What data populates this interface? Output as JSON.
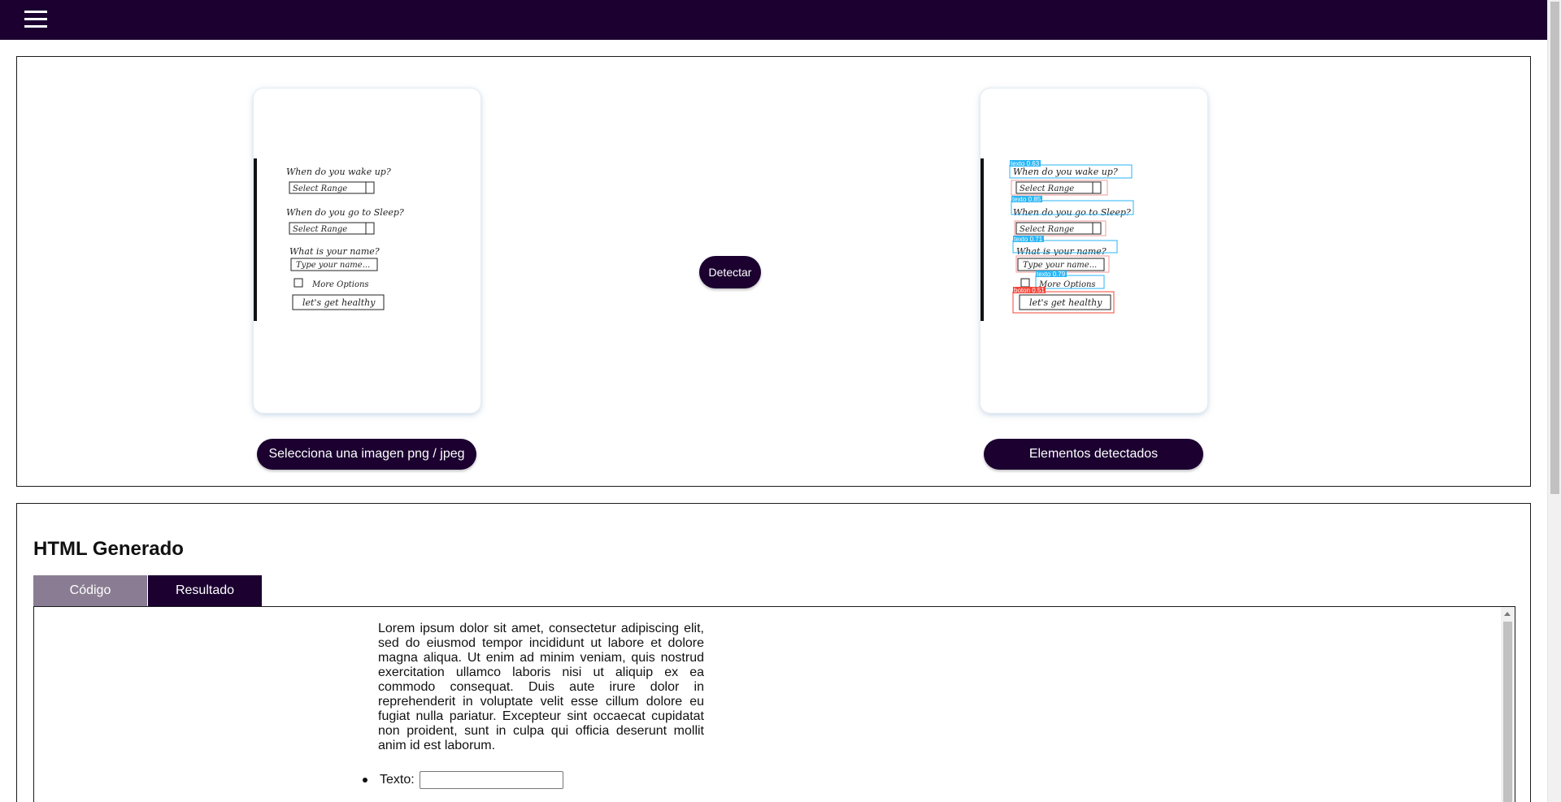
{
  "header": {
    "menu_icon": "hamburger-menu-icon"
  },
  "upload": {
    "select_button": "Selecciona una imagen png / jpeg",
    "detect_button": "Detectar",
    "detected_button": "Elementos detectados",
    "sketch_lines": [
      "When do you wake up?",
      "Select Range",
      "When do you go to Sleep?",
      "Select Range",
      "What is your name?",
      "Type your name...",
      "More Options",
      "let's get healthy"
    ],
    "detections": [
      "texto 0.63",
      "texto 0.85",
      "texto 0.71",
      "texto 0.79",
      "boton 0.51"
    ]
  },
  "generated": {
    "title": "HTML Generado",
    "tabs": [
      "Código",
      "Resultado"
    ],
    "active_tab": "Resultado",
    "paragraph": "Lorem ipsum dolor sit amet, consectetur adipiscing elit, sed do eiusmod tempor incididunt ut labore et dolore magna aliqua. Ut enim ad minim veniam, quis nostrud exercitation ullamco laboris nisi ut aliquip ex ea commodo consequat. Duis aute irure dolor in reprehenderit in voluptate velit esse cillum dolore eu fugiat nulla pariatur. Excepteur sint occaecat cupidatat non proident, sunt in culpa qui officia deserunt mollit anim id est laborum.",
    "field_label": "Texto:",
    "field_value": ""
  },
  "colors": {
    "brand": "#1b0030",
    "tab_inactive": "#8a7d93",
    "detect_text": "#29b6f6",
    "detect_button": "#f44336"
  }
}
